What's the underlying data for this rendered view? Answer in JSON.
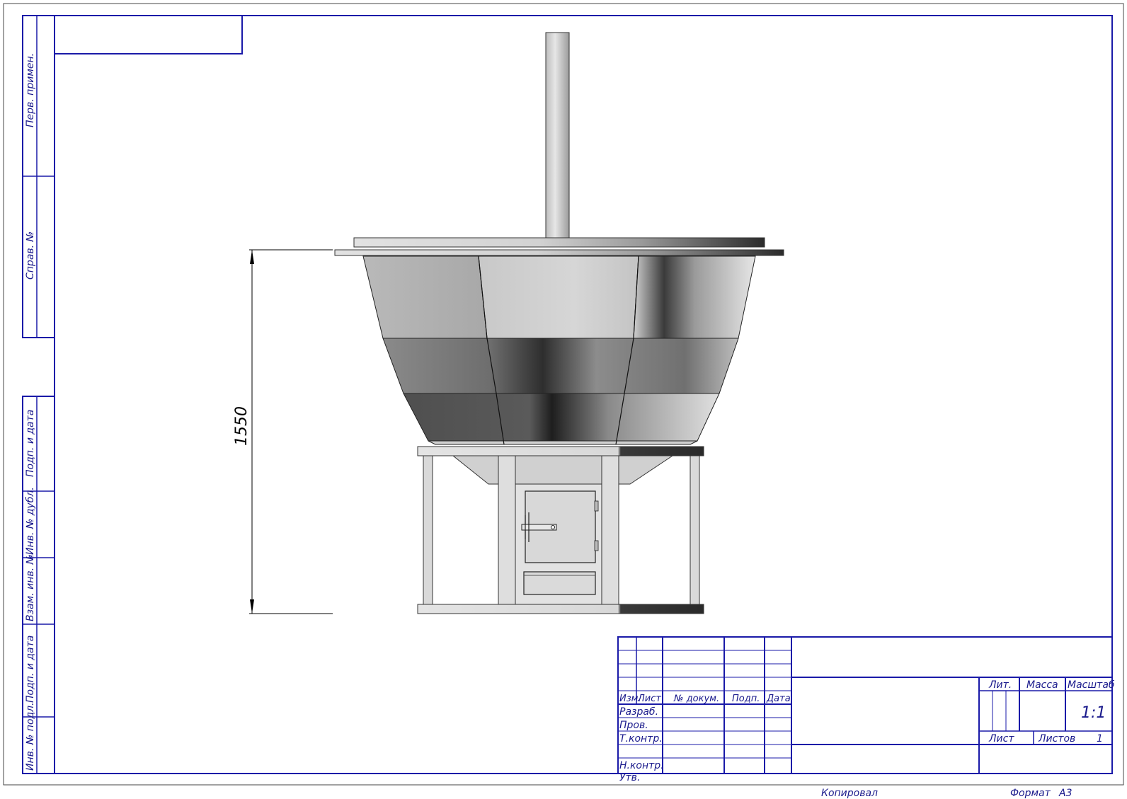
{
  "colors": {
    "frame": "#1a1aa8",
    "text": "#1a1a8c",
    "ink": "#000000"
  },
  "side_columns": {
    "perv_primen": "Перв. примен.",
    "sprav_no": "Справ. №",
    "podp_i_data_top": "Подп. и дата",
    "inv_no_dubl": "Инв. № дубл.",
    "vzam_inv_no": "Взам. инв. №",
    "podp_i_data_bottom": "Подп. и дата",
    "inv_no_podl": "Инв. № подл."
  },
  "dimension": {
    "height_label": "1550"
  },
  "title_block": {
    "headers": {
      "izm": "Изм.",
      "list": "Лист",
      "no_dokum": "№ докум.",
      "podp": "Подп.",
      "data": "Дата"
    },
    "roles": {
      "razrab": "Разраб.",
      "prov": "Пров.",
      "t_kontr": "Т.контр.",
      "n_kontr": "Н.контр.",
      "utv": "Утв."
    },
    "lit_label": "Лит.",
    "massa_label": "Масса",
    "masshtab_label": "Масштаб",
    "scale_value": "1:1",
    "sheet_label": "Лист",
    "sheets_label": "Листов",
    "sheets_count": "1"
  },
  "footer": {
    "kopiroval": "Копировал",
    "format_label": "Формат",
    "format_value": "A3"
  }
}
